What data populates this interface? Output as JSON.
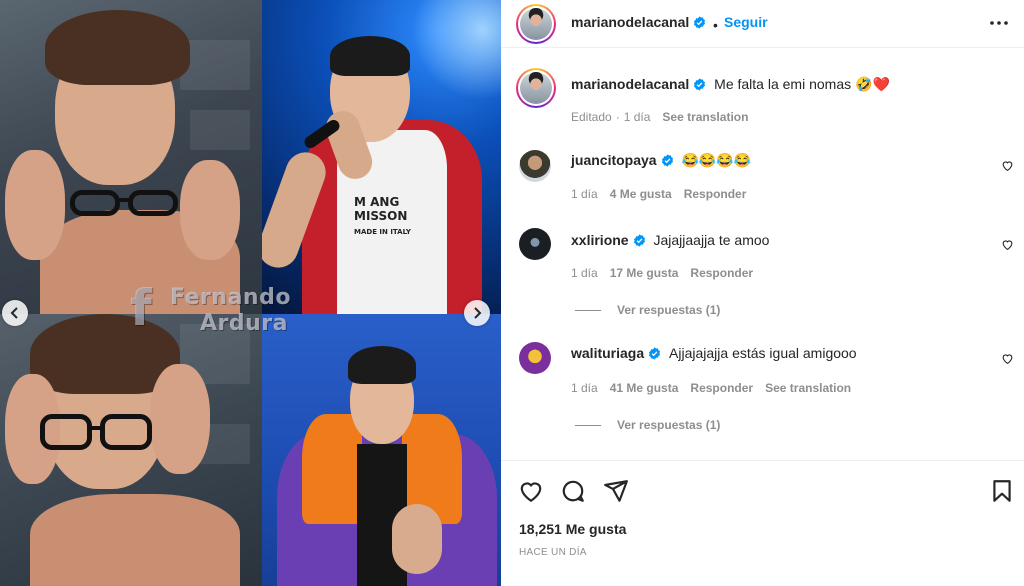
{
  "post": {
    "media": {
      "watermark_line1": "Fernando",
      "watermark_line2": "Ardura",
      "shirt_print": "M ANG\nMISSON\nMADE IN ITALY"
    },
    "author": {
      "username": "marianodelacanal",
      "verified": true,
      "separator": "•",
      "follow_label": "Seguir"
    },
    "caption": {
      "username": "marianodelacanal",
      "text": "Me falta la emi nomas 🤣❤️",
      "edited": "Editado",
      "time": "1 día",
      "translate_label": "See translation"
    },
    "comments": [
      {
        "username": "juancitopaya",
        "text": "😂😂😂😂",
        "time": "1 día",
        "likes": "4 Me gusta",
        "reply_label": "Responder"
      },
      {
        "username": "xxlirione",
        "text": "Jajajjaajja te amoo",
        "time": "1 día",
        "likes": "17 Me gusta",
        "reply_label": "Responder",
        "view_replies": "Ver respuestas (1)"
      },
      {
        "username": "walituriaga",
        "text": "Ajjajajajja estás igual amigooo",
        "time": "1 día",
        "likes": "41 Me gusta",
        "reply_label": "Responder",
        "translate_label": "See translation",
        "view_replies": "Ver respuestas (1)"
      }
    ],
    "likes_count": "18,251 Me gusta",
    "posted_ago": "HACE UN DÍA"
  },
  "colors": {
    "accent": "#0095f6",
    "verified": "#0095f6",
    "muted": "#8e8e8e",
    "text": "#262626"
  },
  "icons": [
    "chevron-left-icon",
    "chevron-right-icon",
    "verified-badge-icon",
    "more-options-icon",
    "heart-icon",
    "comment-icon",
    "share-icon",
    "bookmark-icon"
  ]
}
